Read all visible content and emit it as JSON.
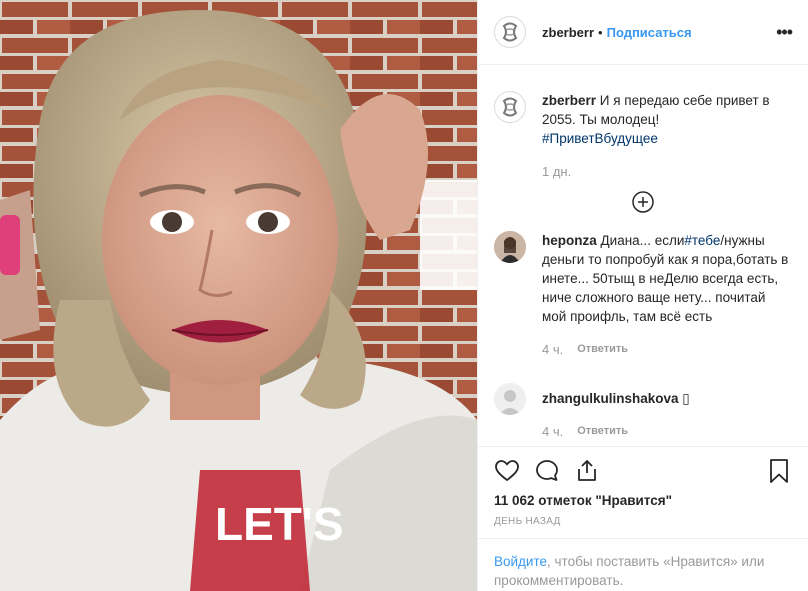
{
  "post": {
    "author": "zberberr",
    "dot": "•",
    "follow_label": "Подписаться",
    "more_label": "•••",
    "caption": {
      "user": "zberberr",
      "text": "И я передаю себе привет в 2055. Ты молодец!",
      "hashtag": "#ПриветВбудущее",
      "time": "1 дн."
    },
    "comments": [
      {
        "user": "heponza",
        "text_before": "Диана... если",
        "hashtag": "#тебе",
        "text_after": "/нужны деньги то попробуй как я пора,ботать в инете... 50тыщ в неДелю всегда есть, ниче сложного ваще нету... почитай мой проифль, там всё есть",
        "time": "4 ч.",
        "reply_label": "Ответить"
      },
      {
        "user": "zhangulkulinshakova",
        "text": "▯",
        "time": "4 ч.",
        "reply_label": "Ответить"
      }
    ],
    "likes": "11 062 отметок \"Нравится\"",
    "posted": "ДЕНЬ НАЗАД",
    "login": {
      "link": "Войдите",
      "text": ", чтобы поставить «Нравится» или прокомментировать."
    },
    "shirt_print": "LET'S"
  },
  "icons": {
    "heart": "heart-icon",
    "comment": "comment-icon",
    "share": "share-icon",
    "bookmark": "bookmark-icon",
    "plus": "plus-circle-icon"
  },
  "colors": {
    "link": "#3897f0",
    "hashtag": "#003569",
    "muted": "#999999",
    "text": "#262626",
    "border": "#efefef"
  }
}
